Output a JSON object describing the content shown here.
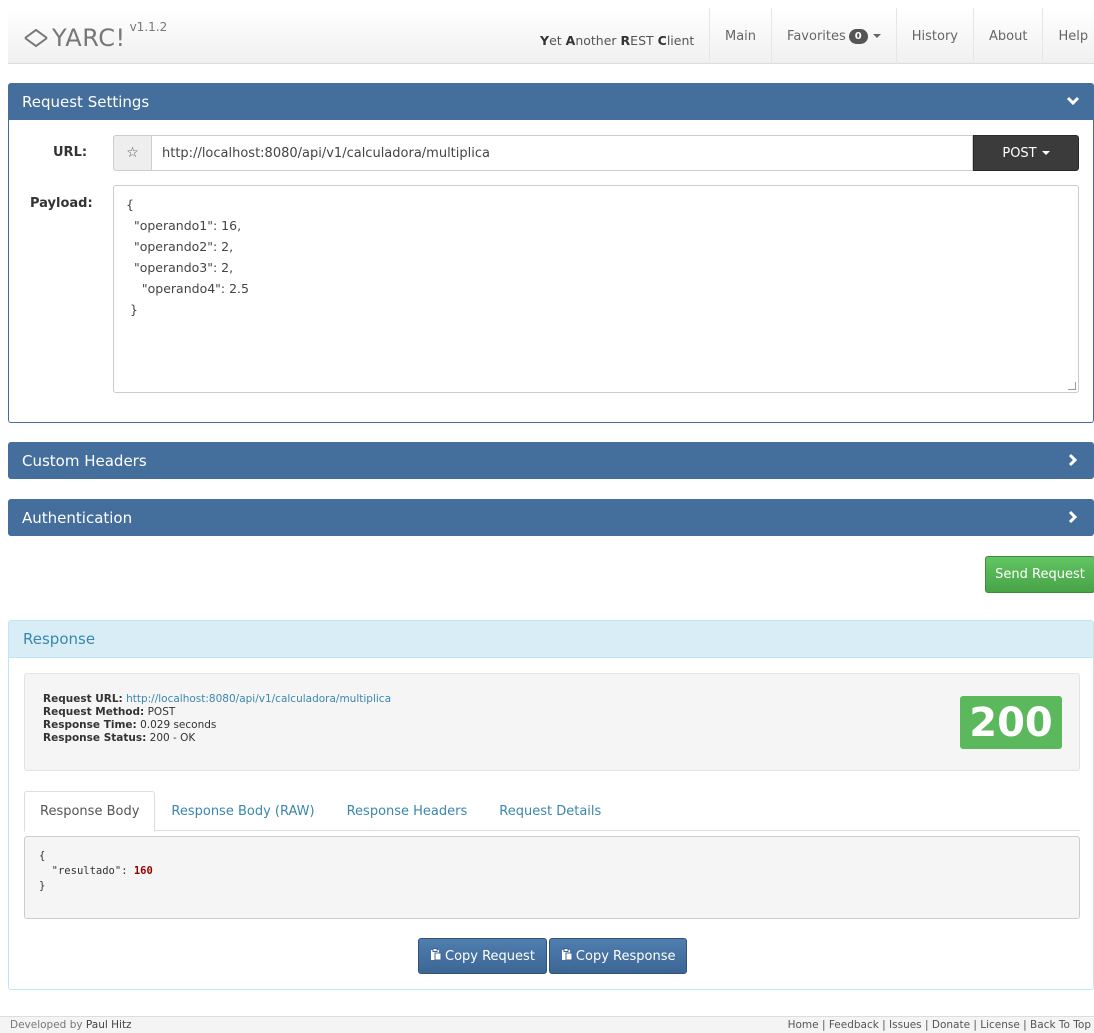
{
  "navbar": {
    "brand": "YARC!",
    "version": "v1.1.2",
    "tagline": [
      {
        "bold": "Y",
        "rest": "et "
      },
      {
        "bold": "A",
        "rest": "nother "
      },
      {
        "bold": "R",
        "rest": "EST "
      },
      {
        "bold": "C",
        "rest": "lient"
      }
    ],
    "items": [
      {
        "label": "Main"
      },
      {
        "label": "Favorites",
        "badge": "0"
      },
      {
        "label": "History"
      },
      {
        "label": "About"
      },
      {
        "label": "Help"
      }
    ]
  },
  "request_settings": {
    "title": "Request Settings",
    "url_label": "URL:",
    "url_value": "http://localhost:8080/api/v1/calculadora/multiplica",
    "method": "POST",
    "payload_label": "Payload:",
    "payload": "{\n  \"operando1\": 16,\n  \"operando2\": 2,\n  \"operando3\": 2,\n    \"operando4\": 2.5\n }"
  },
  "custom_headers": {
    "title": "Custom Headers"
  },
  "authentication": {
    "title": "Authentication"
  },
  "send_button": "Send Request",
  "response": {
    "title": "Response",
    "summary": {
      "url_label": "Request URL:",
      "url_value": "http://localhost:8080/api/v1/calculadora/multiplica",
      "method_label": "Request Method:",
      "method_value": "POST",
      "time_label": "Response Time:",
      "time_value": "0.029 seconds",
      "status_label": "Response Status:",
      "status_value": "200 - OK"
    },
    "status_code": "200",
    "status_color": "#5cb85c",
    "tabs": [
      "Response Body",
      "Response Body (RAW)",
      "Response Headers",
      "Request Details"
    ],
    "active_tab": "Response Body",
    "body": {
      "open": "{",
      "key": "\"resultado\"",
      "value": "160",
      "close": "}"
    },
    "copy_request": "Copy Request",
    "copy_response": "Copy Response"
  },
  "footer": {
    "developed_by": "Developed by",
    "author": "Paul Hitz",
    "links": "Home | Feedback | Issues | Donate | License | Back To Top"
  },
  "colors": {
    "panel_primary": "#446e9b",
    "panel_info": "#d9edf7",
    "success": "#5cb85c",
    "dark_button": "#3b3b3b"
  }
}
